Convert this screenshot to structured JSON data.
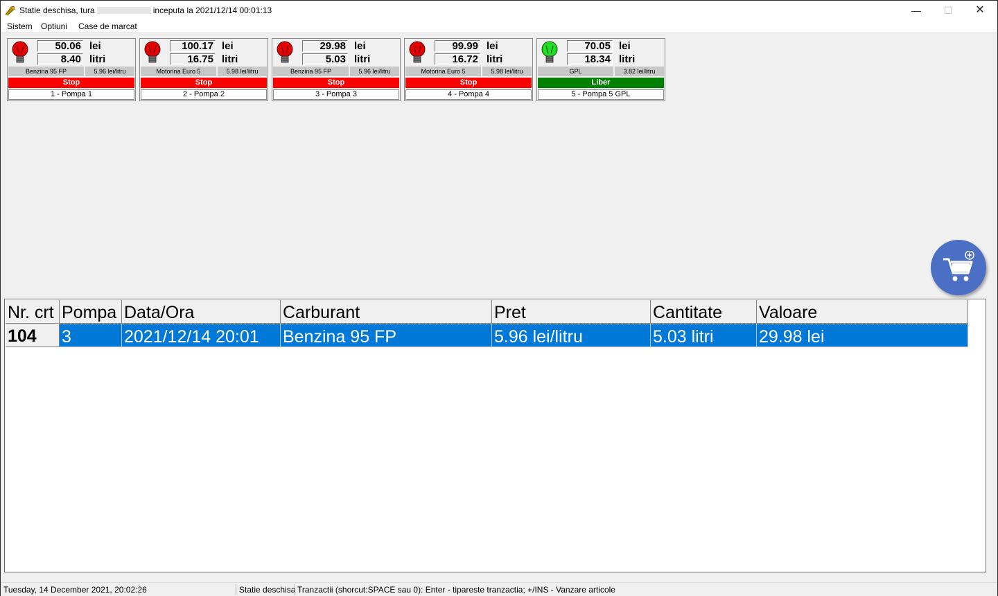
{
  "window": {
    "title_prefix": "Statie deschisa, tura",
    "title_suffix": "inceputa la 2021/12/14 00:01:13",
    "minimize": "—",
    "maximize": "☐",
    "close": "✕"
  },
  "menu": [
    "Sistem",
    "Optiuni",
    "Case de marcat"
  ],
  "pumps": [
    {
      "lei": "50.06",
      "litri": "8.40",
      "lei_unit": "lei",
      "litri_unit": "litri",
      "fuel": "Benzina 95 FP",
      "price": "5.96 lei/litru",
      "status": "Stop",
      "label": "1 - Pompa 1",
      "light": "red"
    },
    {
      "lei": "100.17",
      "litri": "16.75",
      "lei_unit": "lei",
      "litri_unit": "litri",
      "fuel": "Motorina Euro 5",
      "price": "5.98 lei/litru",
      "status": "Stop",
      "label": "2 - Pompa 2",
      "light": "red"
    },
    {
      "lei": "29.98",
      "litri": "5.03",
      "lei_unit": "lei",
      "litri_unit": "litri",
      "fuel": "Benzina 95 FP",
      "price": "5.96 lei/litru",
      "status": "Stop",
      "label": "3 - Pompa 3",
      "light": "red"
    },
    {
      "lei": "99.99",
      "litri": "16.72",
      "lei_unit": "lei",
      "litri_unit": "litri",
      "fuel": "Motorina Euro 5",
      "price": "5.98 lei/litru",
      "status": "Stop",
      "label": "4 - Pompa 4",
      "light": "red"
    },
    {
      "lei": "70.05",
      "litri": "18.34",
      "lei_unit": "lei",
      "litri_unit": "litri",
      "fuel": "GPL",
      "price": "3.82 lei/litru",
      "status": "Liber",
      "label": "5 - Pompa 5 GPL",
      "light": "green"
    }
  ],
  "colors": {
    "stop": "#ff0000",
    "liber": "#008000",
    "selection": "#0078d7",
    "cart_button": "#4a6fc4"
  },
  "cart_button": {
    "icon": "cart-plus-icon"
  },
  "transactions": {
    "columns": [
      "Nr. crt",
      "Pompa",
      "Data/Ora",
      "Carburant",
      "Pret",
      "Cantitate",
      "Valoare"
    ],
    "rows": [
      {
        "nr": "104",
        "pompa": "3",
        "data": "2021/12/14 20:01",
        "carburant": "Benzina 95 FP",
        "pret": "5.96 lei/litru",
        "cantitate": "5.03 litri",
        "valoare": "29.98 lei"
      }
    ]
  },
  "statusbar": {
    "datetime": "Tuesday, 14 December 2021, 20:02:26",
    "state": "Statie deschisa",
    "hint": "Tranzactii (shorcut:SPACE sau 0): Enter - tipareste tranzactia; +/INS - Vanzare articole"
  }
}
